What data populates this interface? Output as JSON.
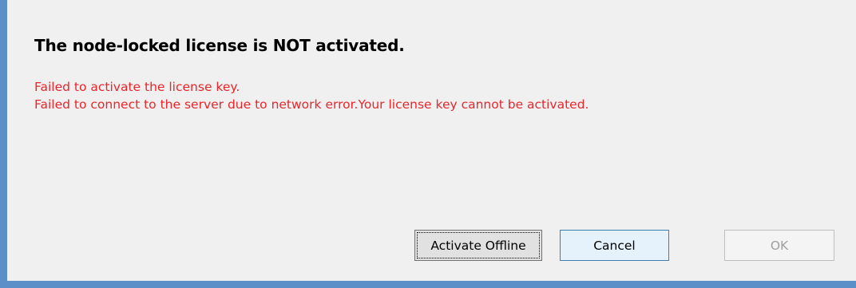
{
  "dialog": {
    "headline": "The node-locked license is NOT activated.",
    "error_color": "#e8262b",
    "messages": [
      "Failed to activate the license key.",
      "Failed to connect to the server due to network error.Your license key cannot be activated."
    ]
  },
  "buttons": {
    "activate_offline": "Activate Offline",
    "cancel": "Cancel",
    "ok": "OK"
  }
}
